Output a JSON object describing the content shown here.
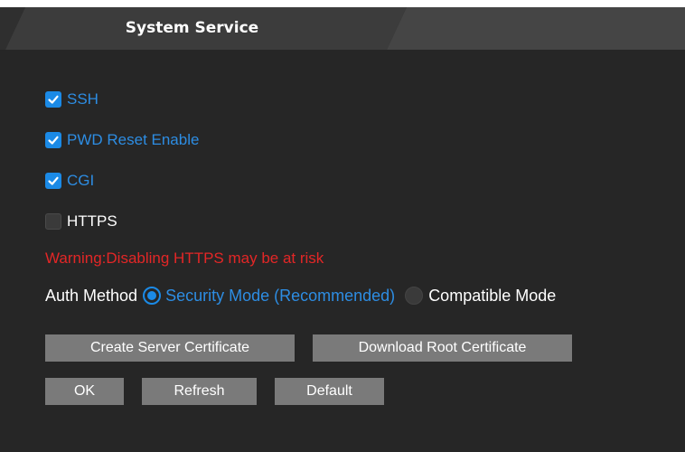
{
  "tab": {
    "title": "System Service"
  },
  "options": [
    {
      "label": "SSH",
      "checked": true
    },
    {
      "label": "PWD Reset Enable",
      "checked": true
    },
    {
      "label": "CGI",
      "checked": true
    },
    {
      "label": "HTTPS",
      "checked": false
    }
  ],
  "warning": "Warning:Disabling HTTPS may be at risk",
  "auth": {
    "label": "Auth Method",
    "modes": [
      {
        "label": "Security Mode (Recommended)",
        "selected": true
      },
      {
        "label": "Compatible Mode",
        "selected": false
      }
    ]
  },
  "buttons": {
    "create_cert": "Create Server Certificate",
    "download_root_cert": "Download Root Certificate",
    "ok": "OK",
    "refresh": "Refresh",
    "default": "Default"
  },
  "colors": {
    "background": "#262626",
    "tab_active": "#3c3c3c",
    "accent": "#1b8ae6",
    "option_label": "#2d8de3",
    "warning": "#e32626",
    "button": "#7a7a7a"
  }
}
